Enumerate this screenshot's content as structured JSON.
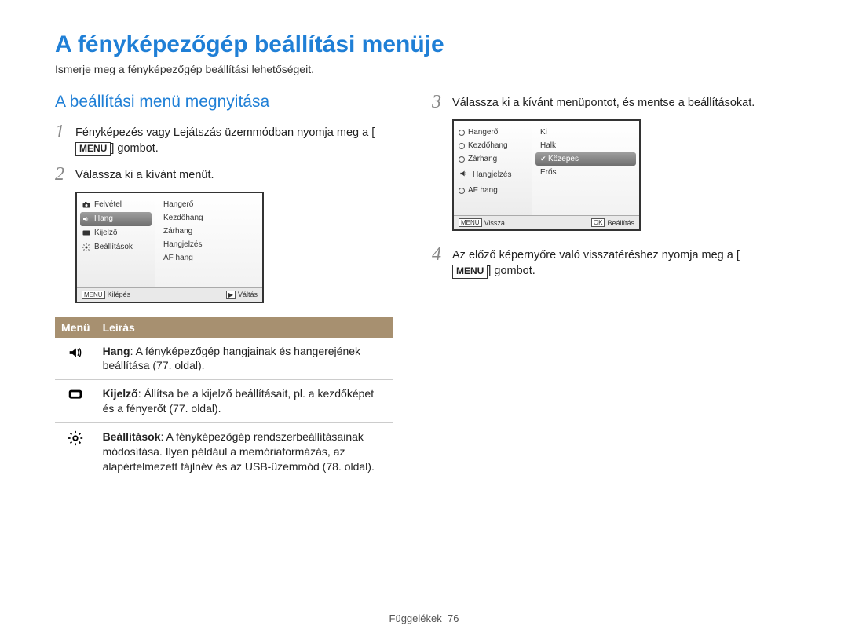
{
  "page": {
    "title": "A fényképezőgép beállítási menüje",
    "intro": "Ismerje meg a fényképezőgép beállítási lehetőségeit.",
    "section_title": "A beállítási menü megnyitása",
    "footer_label": "Függelékek",
    "footer_page": "76"
  },
  "buttons": {
    "menu": "MENU"
  },
  "steps_left": {
    "s1_pre": "Fényképezés vagy Lejátszás üzemmódban nyomja meg a [",
    "s1_post": "] gombot.",
    "s2": "Válassza ki a kívánt menüt."
  },
  "steps_right": {
    "s3": "Válassza ki a kívánt menüpontot, és mentse a beállításokat.",
    "s4_pre": "Az előző képernyőre való visszatéréshez nyomja meg a [",
    "s4_post": "] gombot."
  },
  "cam1": {
    "left": [
      "Felvétel",
      "Hang",
      "Kijelző",
      "Beállítások"
    ],
    "right": [
      "Hangerő",
      "Kezdőhang",
      "Zárhang",
      "Hangjelzés",
      "AF hang"
    ],
    "footer_left_btn": "MENU",
    "footer_left": "Kilépés",
    "footer_right_btn": "▶",
    "footer_right": "Váltás"
  },
  "cam2": {
    "left": [
      "Hangerő",
      "Kezdőhang",
      "Zárhang",
      "Hangjelzés",
      "AF hang"
    ],
    "right": [
      "Ki",
      "Halk",
      "Közepes",
      "Erős"
    ],
    "footer_left_btn": "MENU",
    "footer_left": "Vissza",
    "footer_right_btn": "OK",
    "footer_right": "Beállítás"
  },
  "table": {
    "head_menu": "Menü",
    "head_desc": "Leírás",
    "rows": [
      {
        "strong": "Hang",
        "text": ": A fényképezőgép hangjainak és hangerejének beállítása (77. oldal)."
      },
      {
        "strong": "Kijelző",
        "text": ": Állítsa be a kijelző beállításait, pl. a kezdőképet és a fényerőt (77. oldal)."
      },
      {
        "strong": "Beállítások",
        "text": ": A fényképezőgép rendszerbeállításainak módosítása. Ilyen például a memóriaformázás, az alapértelmezett fájlnév és az USB-üzemmód (78. oldal)."
      }
    ]
  }
}
